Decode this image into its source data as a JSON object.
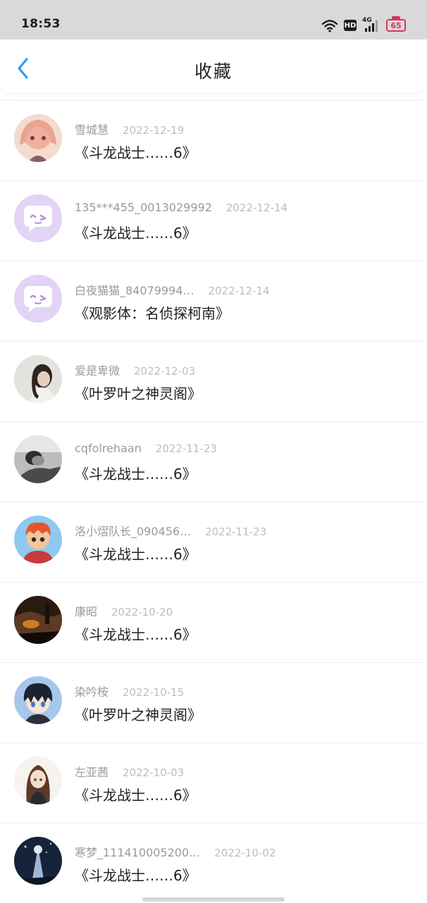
{
  "status_bar": {
    "time": "18:53",
    "hd": "HD",
    "network": "4G",
    "battery": "65"
  },
  "header": {
    "title": "收藏",
    "back_icon": "chevron-left-icon",
    "accent_color": "#2f9bf5"
  },
  "favorites": [
    {
      "user": "雪城慧",
      "date": "2022-12-19",
      "title": "《斗龙战士……6》",
      "avatar": "anime-girl-pink"
    },
    {
      "user": "135***455_0013029992",
      "date": "2022-12-14",
      "title": "《斗龙战士……6》",
      "avatar": "default-chat-bubble"
    },
    {
      "user": "白夜猫猫_84079994…",
      "date": "2022-12-14",
      "title": "《观影体：名侦探柯南》",
      "avatar": "default-chat-bubble"
    },
    {
      "user": "爱是卑微",
      "date": "2022-12-03",
      "title": "《叶罗叶之神灵阁》",
      "avatar": "photo-girl-grey"
    },
    {
      "user": "cqfolrehaan",
      "date": "2022-11-23",
      "title": "《斗龙战士……6》",
      "avatar": "photo-bw"
    },
    {
      "user": "洛小熠队长_090456…",
      "date": "2022-11-23",
      "title": "《斗龙战士……6》",
      "avatar": "cartoon-boy"
    },
    {
      "user": "康昭",
      "date": "2022-10-20",
      "title": "《斗龙战士……6》",
      "avatar": "dark-scene"
    },
    {
      "user": "染吟桉",
      "date": "2022-10-15",
      "title": "《叶罗叶之神灵阁》",
      "avatar": "anime-boy-blue"
    },
    {
      "user": "左亚茜",
      "date": "2022-10-03",
      "title": "《斗龙战士……6》",
      "avatar": "anime-girl-brown"
    },
    {
      "user": "寒梦_111410005200…",
      "date": "2022-10-02",
      "title": "《斗龙战士……6》",
      "avatar": "night-figure"
    }
  ]
}
